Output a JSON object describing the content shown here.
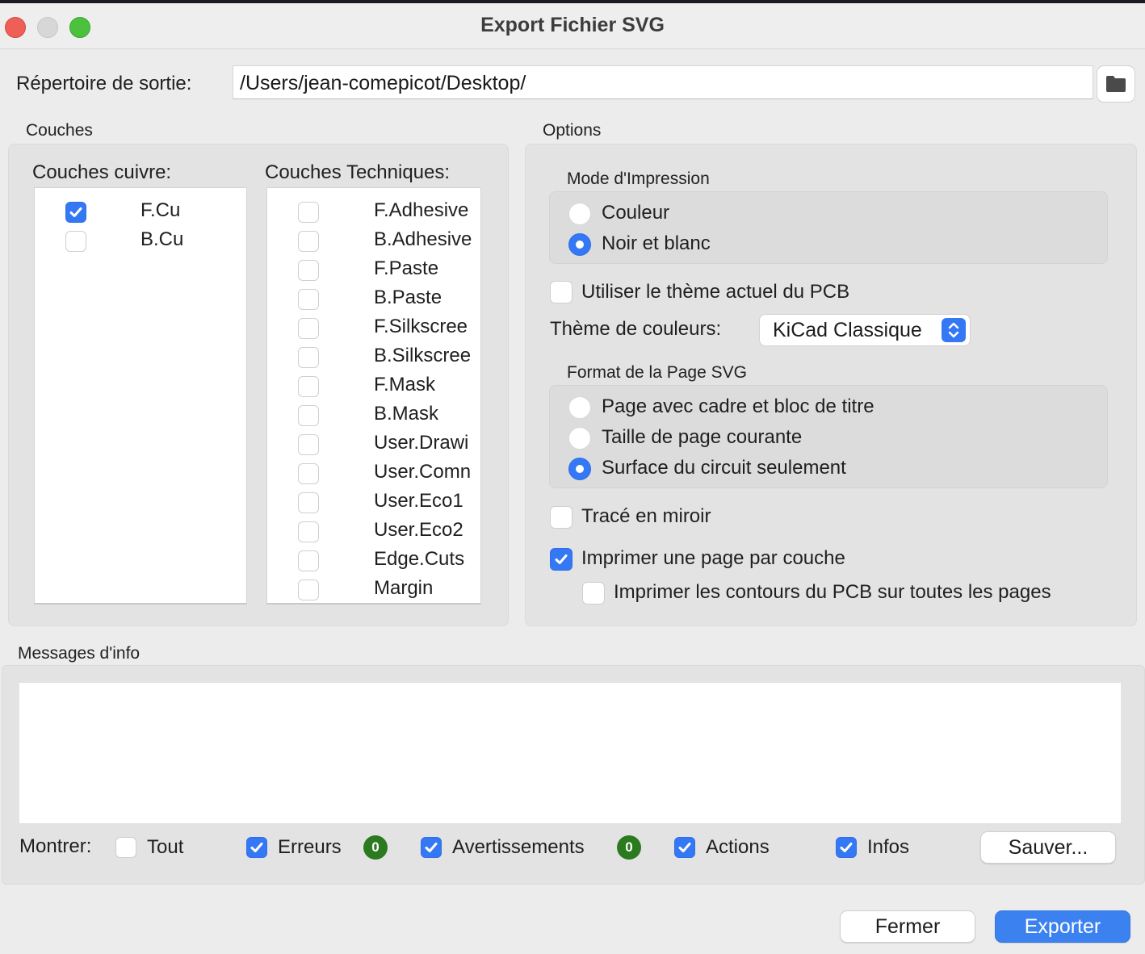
{
  "window": {
    "title": "Export Fichier SVG"
  },
  "output": {
    "label": "Répertoire de sortie:",
    "path_value": "/Users/jean-comepicot/Desktop/",
    "browse_icon": "folder-icon"
  },
  "layers": {
    "group_label": "Couches",
    "copper": {
      "title": "Couches cuivre:",
      "items": [
        {
          "name": "F.Cu",
          "checked": true
        },
        {
          "name": "B.Cu",
          "checked": false
        }
      ]
    },
    "technical": {
      "title": "Couches Techniques:",
      "items": [
        {
          "name": "F.Adhesive",
          "checked": false
        },
        {
          "name": "B.Adhesive",
          "checked": false
        },
        {
          "name": "F.Paste",
          "checked": false
        },
        {
          "name": "B.Paste",
          "checked": false
        },
        {
          "name": "F.Silkscree",
          "checked": false
        },
        {
          "name": "B.Silkscree",
          "checked": false
        },
        {
          "name": "F.Mask",
          "checked": false
        },
        {
          "name": "B.Mask",
          "checked": false
        },
        {
          "name": "User.Drawi",
          "checked": false
        },
        {
          "name": "User.Comn",
          "checked": false
        },
        {
          "name": "User.Eco1",
          "checked": false
        },
        {
          "name": "User.Eco2",
          "checked": false
        },
        {
          "name": "Edge.Cuts",
          "checked": false
        },
        {
          "name": "Margin",
          "checked": false
        }
      ]
    }
  },
  "options": {
    "group_label": "Options",
    "print_mode": {
      "label": "Mode d'Impression",
      "choices": [
        {
          "label": "Couleur",
          "selected": false
        },
        {
          "label": "Noir et blanc",
          "selected": true
        }
      ]
    },
    "use_pcb_theme": {
      "label": "Utiliser le thème actuel du PCB",
      "checked": false
    },
    "color_theme": {
      "label": "Thème de couleurs:",
      "value": "KiCad Classique"
    },
    "page_format": {
      "label": "Format de la Page SVG",
      "choices": [
        {
          "label": "Page avec cadre et bloc de titre",
          "selected": false
        },
        {
          "label": "Taille de page courante",
          "selected": false
        },
        {
          "label": "Surface du circuit seulement",
          "selected": true
        }
      ]
    },
    "mirror": {
      "label": "Tracé en miroir",
      "checked": false
    },
    "one_page_per_layer": {
      "label": "Imprimer une page par couche",
      "checked": true
    },
    "board_edges_all_pages": {
      "label": "Imprimer les contours du PCB sur toutes les pages",
      "checked": false
    }
  },
  "messages": {
    "group_label": "Messages d'info",
    "content": "",
    "show_label": "Montrer:",
    "filters": {
      "all": {
        "label": "Tout",
        "checked": false
      },
      "errors": {
        "label": "Erreurs",
        "checked": true,
        "count": "0"
      },
      "warnings": {
        "label": "Avertissements",
        "checked": true,
        "count": "0"
      },
      "actions": {
        "label": "Actions",
        "checked": true
      },
      "infos": {
        "label": "Infos",
        "checked": true
      }
    },
    "save_button": "Sauver..."
  },
  "footer": {
    "close_button": "Fermer",
    "export_button": "Exporter"
  },
  "colors": {
    "accent": "#3478f6",
    "badge_green": "#2b7a1f",
    "window_bg": "#ececec"
  }
}
